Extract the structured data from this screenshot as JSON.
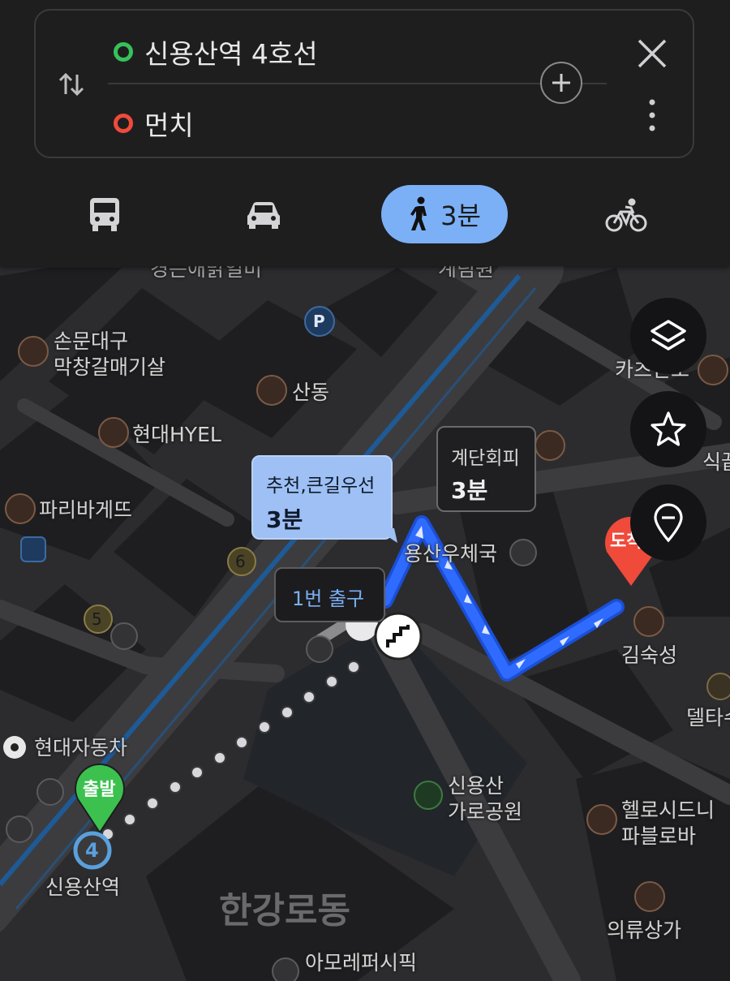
{
  "header": {
    "origin": "신용산역 4호선",
    "destination": "먼치",
    "origin_color": "#35c25a",
    "destination_color": "#f04a3b"
  },
  "modes": {
    "active": "walk",
    "walk_time": "3분",
    "accent": "#7bb0f6"
  },
  "route_bubbles": {
    "recommended_title": "추천,큰길우선",
    "recommended_time": "3분",
    "stairs_title": "계단회피",
    "stairs_time": "3분",
    "exit_label": "1번 출구"
  },
  "markers": {
    "start": "출발",
    "end": "도착",
    "station_line": "4"
  },
  "map_labels": {
    "top_left_cut": "경는애맑얼미",
    "top_center_cut": "계림원",
    "sonmun": "손문대구\n막창갈매기살",
    "sandong": "산동",
    "hyel": "현대HYEL",
    "paris": "파리바게뜨",
    "post_office": "용산우체국",
    "hyundai_motor": "현대자동차",
    "park": "신용산\n가로공원",
    "kimsuksung": "김숙성",
    "hello_sydney": "헬로시드니\n파블로바",
    "clothing": "의류상가",
    "amore": "아모레퍼시픽",
    "station": "신용산역",
    "district": "한강로동",
    "right_cut_1": "카츠안도",
    "right_cut_2": "식끝",
    "right_cut_3": "델타수",
    "exit_6": "6",
    "exit_5": "5",
    "parking": "P"
  },
  "icons": [
    "swap-icon",
    "add-icon",
    "close-icon",
    "more-icon",
    "bus-icon",
    "car-icon",
    "walk-icon",
    "bike-icon",
    "layers-icon",
    "star-icon",
    "location-pin-icon",
    "stairs-icon"
  ]
}
